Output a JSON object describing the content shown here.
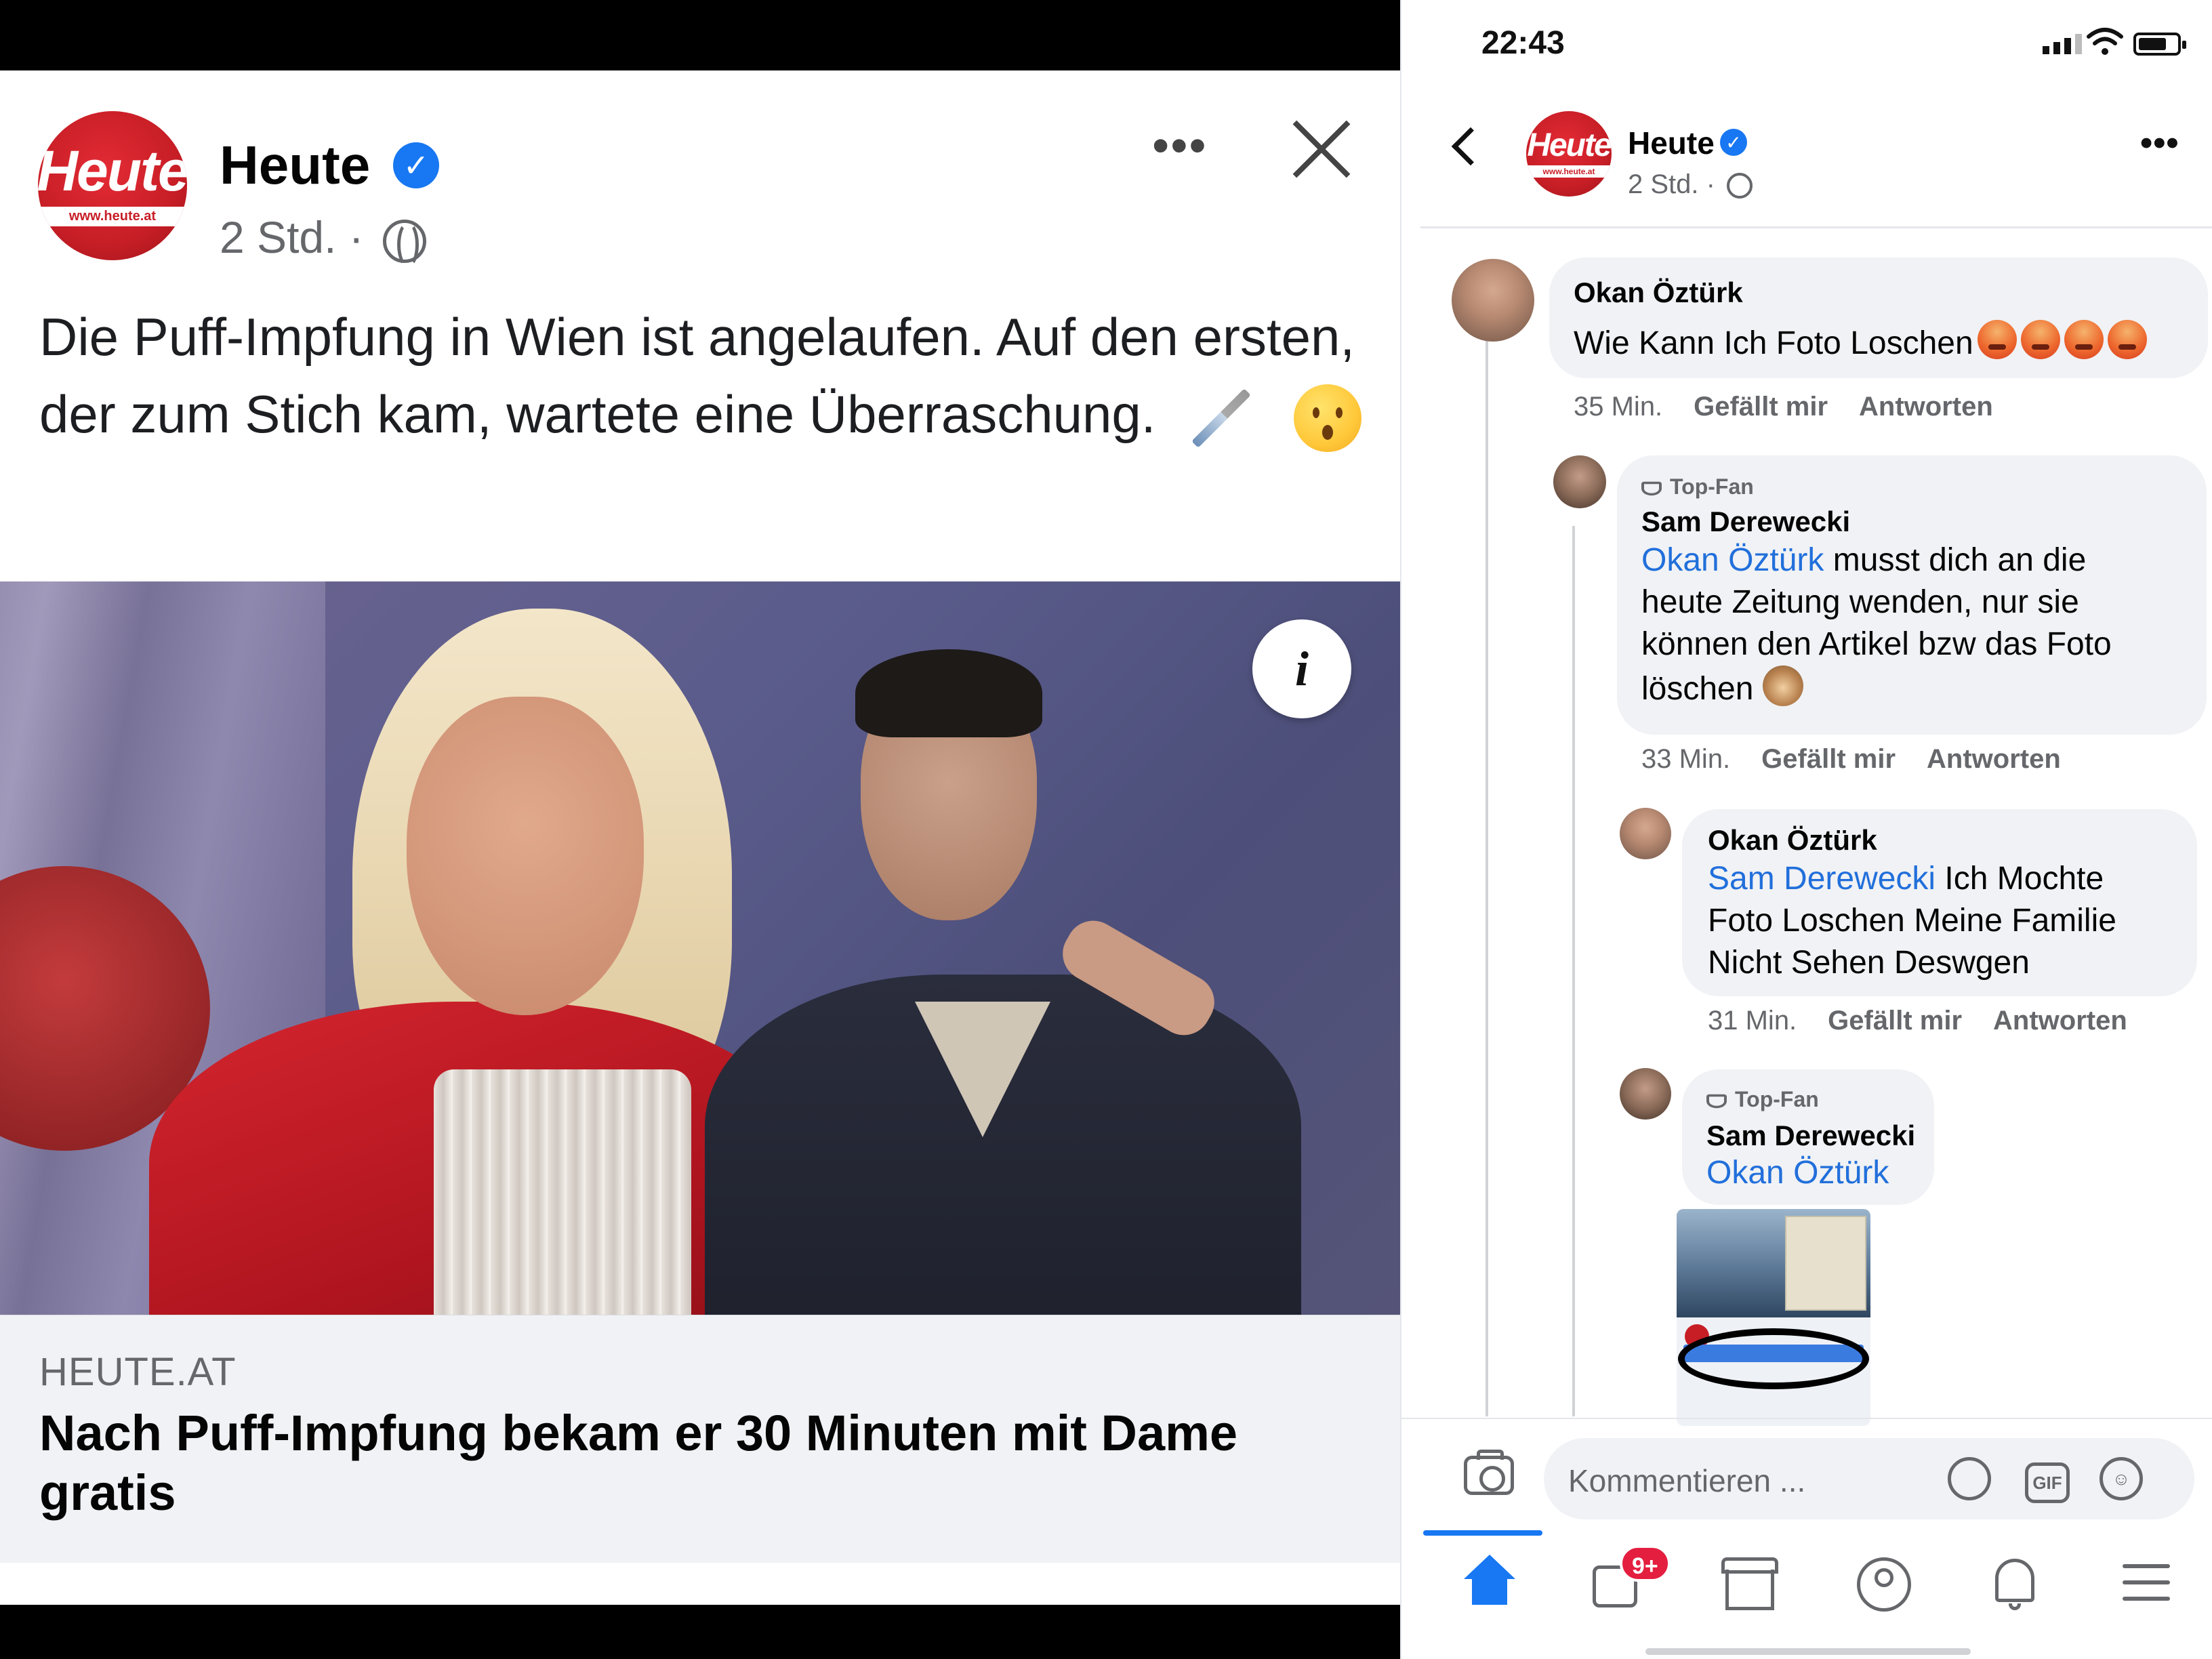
{
  "post": {
    "page_name": "Heute",
    "logo_text": "Heute",
    "logo_url_text": "www.heute.at",
    "meta_time": "2 Std.",
    "meta_sep": "·",
    "caption": "Die Puff-Impfung in Wien ist angelaufen. Auf den ersten, der zum Stich kam, wartete eine Überraschung.",
    "info_label": "i",
    "link": {
      "domain": "HEUTE.AT",
      "headline": "Nach Puff-Impfung bekam er 30 Minuten mit Dame gratis"
    },
    "icons": [
      "verified-icon",
      "globe-icon",
      "more-icon",
      "close-icon",
      "syringe-emoji",
      "hushed-face-emoji",
      "info-icon"
    ]
  },
  "status_bar": {
    "time": "22:43",
    "icons": [
      "signal-icon",
      "wifi-icon",
      "battery-icon"
    ]
  },
  "header": {
    "page_name": "Heute",
    "logo_text": "Heute",
    "meta_time": "2 Std.",
    "meta_sep": "·",
    "icons": [
      "back-icon",
      "verified-icon",
      "globe-icon",
      "more-icon"
    ]
  },
  "comments": [
    {
      "author": "Okan Öztürk",
      "text": "Wie Kann Ich Foto Loschen",
      "emoji": "angry-face x4",
      "time": "35 Min.",
      "like": "Gefällt mir",
      "reply": "Antworten"
    },
    {
      "badge": "Top-Fan",
      "author": "Sam Derewecki",
      "mention": "Okan Öztürk",
      "text_lines": [
        " musst dich an die",
        "heute Zeitung wenden, nur sie",
        "können den Artikel bzw das Foto",
        "löschen"
      ],
      "emoji": "see-no-evil-monkey",
      "time": "33 Min.",
      "like": "Gefällt mir",
      "reply": "Antworten"
    },
    {
      "author": "Okan Öztürk",
      "mention": "Sam Derewecki",
      "text_lines": [
        " Ich Mochte",
        "Foto Loschen Meine Familie",
        "Nicht Sehen Deswgen"
      ],
      "time": "31 Min.",
      "like": "Gefällt mir",
      "reply": "Antworten"
    },
    {
      "badge": "Top-Fan",
      "author": "Sam Derewecki",
      "mention": "Okan Öztürk",
      "attachment": "screenshot-image"
    }
  ],
  "composer": {
    "placeholder": "Kommentieren ...",
    "gif_label": "GIF",
    "icons": [
      "camera-icon",
      "sticker-icon",
      "gif-icon",
      "emoji-icon"
    ]
  },
  "bottom_nav": {
    "items": [
      "home-tab",
      "video-tab",
      "marketplace-tab",
      "profile-tab",
      "notifications-tab",
      "menu-tab"
    ],
    "active": "home-tab",
    "video_badge": "9+",
    "accent": "#1877f2",
    "badge_color": "#e41e3f"
  },
  "colors": {
    "brand_red": "#c71e26",
    "mention_blue": "#216fdb",
    "bubble_bg": "#f0f2f5",
    "link_box_bg": "#f0f2f5"
  }
}
